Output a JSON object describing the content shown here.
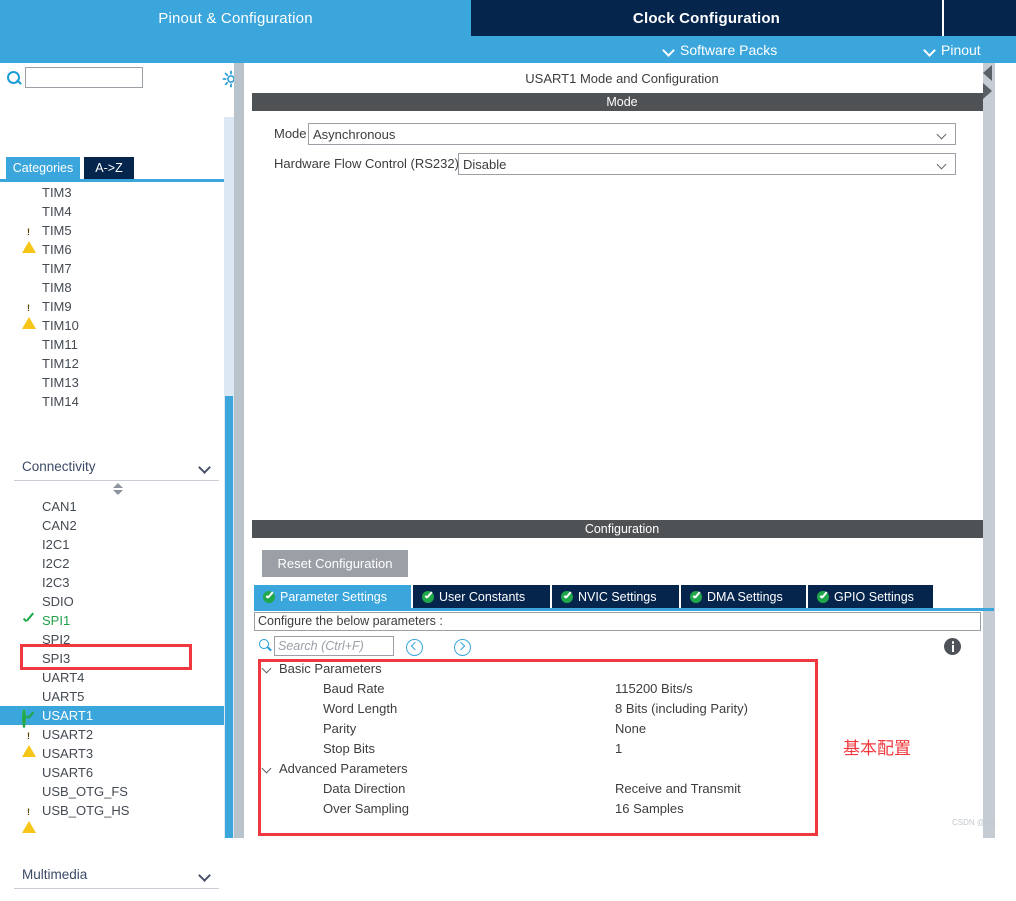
{
  "header": {
    "tabs": [
      {
        "label": "Pinout & Configuration",
        "active": false,
        "style": "light"
      },
      {
        "label": "Clock Configuration",
        "active": true,
        "style": "dark"
      },
      {
        "label": "",
        "active": false,
        "style": "dark"
      }
    ],
    "subbar": [
      {
        "label": "Software Packs",
        "icon": "chevron-down-icon"
      },
      {
        "label": "Pinout",
        "icon": "chevron-down-icon"
      }
    ]
  },
  "sidebar": {
    "search_placeholder": "",
    "search_value": "",
    "gear_icon": "gear-icon",
    "search_icon": "search-icon",
    "view_tabs": [
      {
        "label": "Categories",
        "active": true
      },
      {
        "label": "A->Z",
        "active": false
      }
    ],
    "timers": [
      {
        "label": "TIM3",
        "state": "none"
      },
      {
        "label": "TIM4",
        "state": "none"
      },
      {
        "label": "TIM5",
        "state": "warning"
      },
      {
        "label": "TIM6",
        "state": "none"
      },
      {
        "label": "TIM7",
        "state": "none"
      },
      {
        "label": "TIM8",
        "state": "none"
      },
      {
        "label": "TIM9",
        "state": "warning"
      },
      {
        "label": "TIM10",
        "state": "none"
      },
      {
        "label": "TIM11",
        "state": "none"
      },
      {
        "label": "TIM12",
        "state": "none"
      },
      {
        "label": "TIM13",
        "state": "none"
      },
      {
        "label": "TIM14",
        "state": "none"
      }
    ],
    "groups": [
      {
        "label": "Connectivity",
        "expanded": true
      },
      {
        "label": "Multimedia",
        "expanded": false
      }
    ],
    "connectivity": [
      {
        "label": "CAN1",
        "state": "none",
        "selected": false
      },
      {
        "label": "CAN2",
        "state": "none",
        "selected": false
      },
      {
        "label": "I2C1",
        "state": "none",
        "selected": false
      },
      {
        "label": "I2C2",
        "state": "none",
        "selected": false
      },
      {
        "label": "I2C3",
        "state": "none",
        "selected": false
      },
      {
        "label": "SDIO",
        "state": "none",
        "selected": false
      },
      {
        "label": "SPI1",
        "state": "ok",
        "selected": false
      },
      {
        "label": "SPI2",
        "state": "none",
        "selected": false
      },
      {
        "label": "SPI3",
        "state": "none",
        "selected": false
      },
      {
        "label": "UART4",
        "state": "none",
        "selected": false
      },
      {
        "label": "UART5",
        "state": "none",
        "selected": false
      },
      {
        "label": "USART1",
        "state": "ok-solid",
        "selected": true
      },
      {
        "label": "USART2",
        "state": "warning",
        "selected": false
      },
      {
        "label": "USART3",
        "state": "none",
        "selected": false
      },
      {
        "label": "USART6",
        "state": "none",
        "selected": false
      },
      {
        "label": "USB_OTG_FS",
        "state": "none",
        "selected": false
      },
      {
        "label": "USB_OTG_HS",
        "state": "warning",
        "selected": false
      }
    ]
  },
  "main": {
    "title": "USART1 Mode and Configuration",
    "mode_section_title": "Mode",
    "mode_fields": [
      {
        "label": "Mode",
        "value": "Asynchronous"
      },
      {
        "label": "Hardware Flow Control (RS232)",
        "value": "Disable"
      }
    ],
    "config_section_title": "Configuration",
    "reset_button": "Reset Configuration",
    "config_tabs": [
      {
        "label": "Parameter Settings",
        "active": true
      },
      {
        "label": "User Constants",
        "active": false
      },
      {
        "label": "NVIC Settings",
        "active": false
      },
      {
        "label": "DMA Settings",
        "active": false
      },
      {
        "label": "GPIO Settings",
        "active": false
      }
    ],
    "configure_note": "Configure the below parameters :",
    "param_search_placeholder": "Search (Ctrl+F)",
    "param_search_value": "",
    "parameters": [
      {
        "type": "group",
        "name": "Basic Parameters",
        "value": "",
        "expanded": true
      },
      {
        "type": "leaf",
        "name": "Baud Rate",
        "value": "115200 Bits/s"
      },
      {
        "type": "leaf",
        "name": "Word Length",
        "value": "8 Bits (including Parity)"
      },
      {
        "type": "leaf",
        "name": "Parity",
        "value": "None"
      },
      {
        "type": "leaf",
        "name": "Stop Bits",
        "value": "1"
      },
      {
        "type": "group",
        "name": "Advanced Parameters",
        "value": "",
        "expanded": true
      },
      {
        "type": "leaf",
        "name": "Data Direction",
        "value": "Receive and Transmit"
      },
      {
        "type": "leaf",
        "name": "Over Sampling",
        "value": "16 Samples"
      }
    ]
  },
  "annotations": {
    "basic_config_note": "基本配置",
    "watermark": "CSDN @*wj"
  },
  "colors": {
    "accent_blue": "#3aa6dc",
    "dark_navy": "#06254d",
    "bar_gray": "#4f5254",
    "highlight_red": "#f0393e",
    "ok_green": "#1fa84a",
    "warn_yellow": "#f5c518"
  }
}
